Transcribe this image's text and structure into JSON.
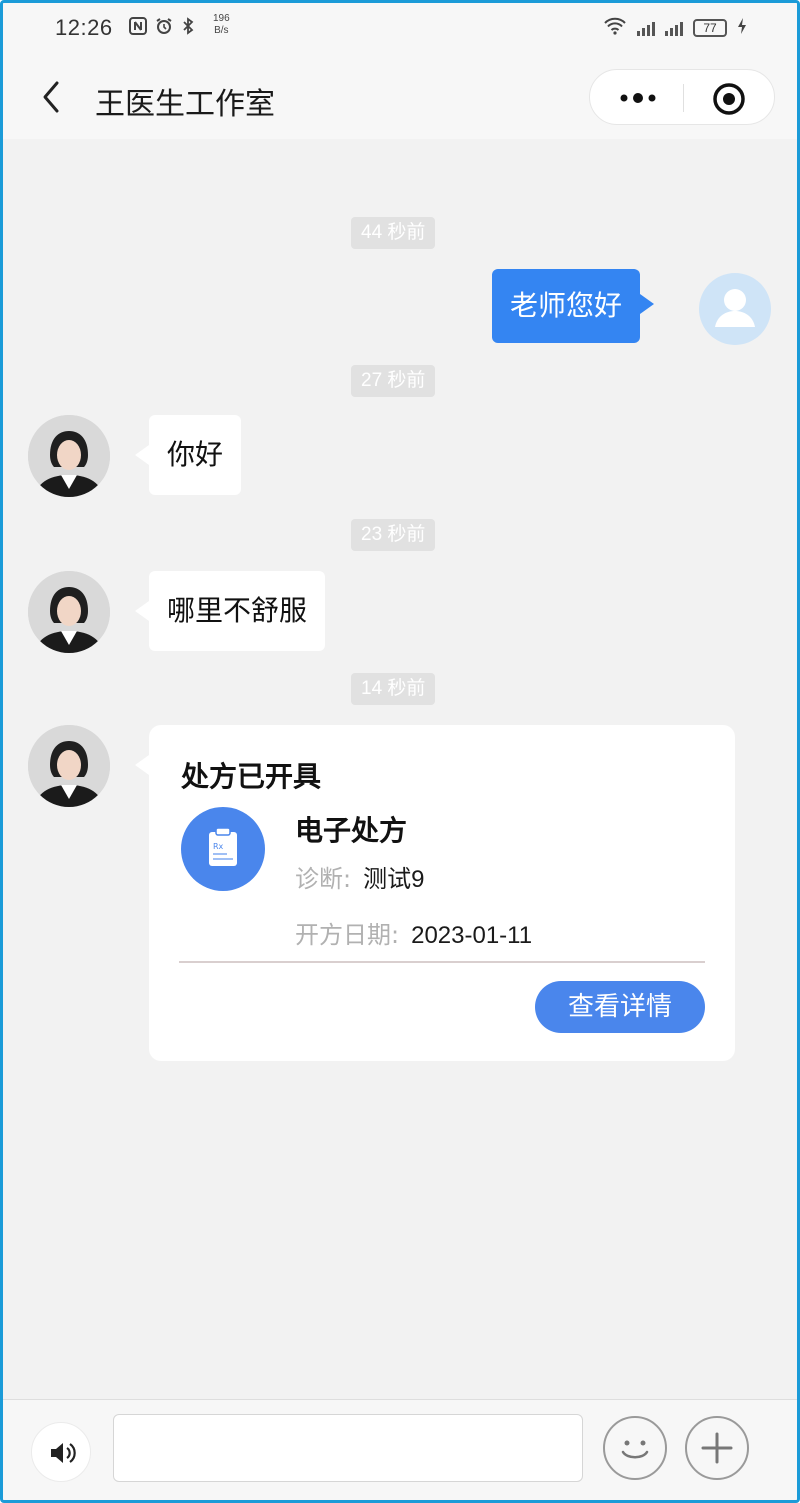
{
  "status_bar": {
    "time": "12:26",
    "speed_value": "196",
    "speed_unit": "B/s",
    "battery": "77",
    "icons": [
      "nfc-icon",
      "alarm-icon",
      "bluetooth-icon",
      "wifi-icon",
      "signal-5g-icon",
      "signal-4g-icon",
      "battery-icon",
      "charging-icon"
    ]
  },
  "header": {
    "title": "王医生工作室",
    "back_icon": "back-arrow-icon",
    "more_icon": "more-dots-icon",
    "close_icon": "target-close-icon"
  },
  "messages": [
    {
      "time": "44 秒前",
      "from": "me",
      "text": "老师您好"
    },
    {
      "time": "27 秒前",
      "from": "doctor",
      "text": "你好"
    },
    {
      "time": "23 秒前",
      "from": "doctor",
      "text": "哪里不舒服"
    },
    {
      "time": "14 秒前",
      "from": "doctor",
      "type": "prescription"
    }
  ],
  "prescription": {
    "title": "处方已开具",
    "name": "电子处方",
    "diagnosis_label": "诊断:",
    "diagnosis_value": "测试9",
    "date_label": "开方日期:",
    "date_value": "2023-01-11",
    "button_label": "查看详情",
    "icon": "clipboard-rx-icon"
  },
  "input_bar": {
    "voice_icon": "speaker-icon",
    "input_value": "",
    "emoji_icon": "smiley-icon",
    "plus_icon": "plus-icon"
  },
  "colors": {
    "frame_border": "#1b9bd8",
    "my_bubble": "#3485f2",
    "accent_button": "#4a86ec",
    "background": "#f2f2f2",
    "time_chip": "#e1e1e1"
  }
}
